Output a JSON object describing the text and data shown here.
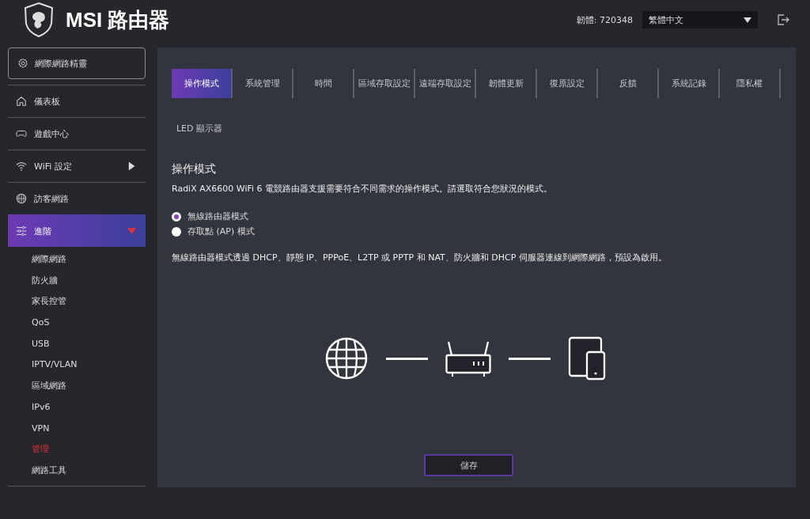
{
  "header": {
    "title": "MSI 路由器",
    "firmware": "韌體: 720348",
    "language": "繁體中文"
  },
  "sidebar": {
    "wizard": "網際網路精靈",
    "items": [
      {
        "label": "儀表板",
        "selected": false
      },
      {
        "label": "遊戲中心",
        "selected": false
      },
      {
        "label": "WiFi 設定",
        "selected": false,
        "expanded": false
      },
      {
        "label": "訪客網路",
        "selected": false
      },
      {
        "label": "進階",
        "selected": true,
        "expanded": true,
        "children": [
          {
            "label": "網際網路",
            "selected": false
          },
          {
            "label": "防火牆",
            "selected": false
          },
          {
            "label": "家長控管",
            "selected": false
          },
          {
            "label": "QoS",
            "selected": false
          },
          {
            "label": "USB",
            "selected": false
          },
          {
            "label": "IPTV/VLAN",
            "selected": false
          },
          {
            "label": "區域網路",
            "selected": false
          },
          {
            "label": "IPv6",
            "selected": false
          },
          {
            "label": "VPN",
            "selected": false
          },
          {
            "label": "管理",
            "selected": true
          },
          {
            "label": "網路工具",
            "selected": false
          }
        ]
      }
    ]
  },
  "tabs": [
    {
      "label": "操作模式",
      "selected": true
    },
    {
      "label": "系統管理",
      "selected": false
    },
    {
      "label": "時間",
      "selected": false
    },
    {
      "label": "區域存取設定",
      "selected": false
    },
    {
      "label": "遠端存取設定",
      "selected": false
    },
    {
      "label": "韌體更新",
      "selected": false
    },
    {
      "label": "復原設定",
      "selected": false
    },
    {
      "label": "反饋",
      "selected": false
    },
    {
      "label": "系統記錄",
      "selected": false
    },
    {
      "label": "隱私權",
      "selected": false
    },
    {
      "label": "LED 顯示器",
      "selected": false
    }
  ],
  "section": {
    "title": "操作模式",
    "description": "RadiX AX6600 WiFi 6 電競路由器支援需要符合不同需求的操作模式。請選取符合您狀況的模式。",
    "modes": [
      {
        "label": "無線路由器模式",
        "selected": true
      },
      {
        "label": "存取點 (AP) 模式",
        "selected": false
      }
    ],
    "note": "無線路由器模式透過 DHCP、靜態 IP、PPPoE、L2TP 或 PPTP 和 NAT、防火牆和 DHCP 伺服器連線到網際網路，預設為啟用。"
  },
  "save_button": "儲存"
}
